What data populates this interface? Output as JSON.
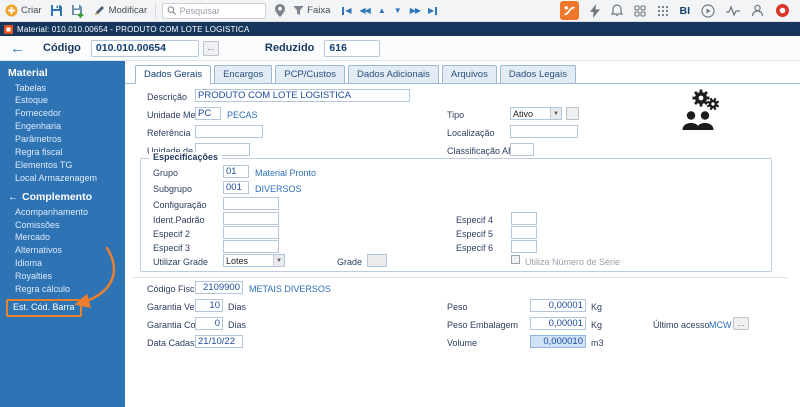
{
  "colors": {
    "accent": "#e7812d",
    "sidebar": "#2e73b4",
    "titlebar": "#16375d"
  },
  "toolbar": {
    "criar_label": "Criar",
    "modificar_label": "Modificar",
    "search_placeholder": "Pesquisar",
    "faixa_label": "Faixa",
    "bi_label": "BI"
  },
  "titlebar": {
    "title": "Material: 010.010.00654 - PRODUTO COM LOTE LOGISTICA"
  },
  "header": {
    "codigo_label": "Código",
    "codigo_value": "010.010.00654",
    "lookup_label": "...",
    "reduzido_label": "Reduzido",
    "reduzido_value": "616"
  },
  "sidebar": {
    "sections": [
      {
        "title": "Material",
        "items": [
          "Tabelas",
          "Estoque",
          "Fornecedor",
          "Engenharia",
          "Parâmetros",
          "Regra fiscal",
          "Elementos TG",
          "Local Armazenagem"
        ]
      },
      {
        "title": "Complemento",
        "items": [
          "Acompanhamento",
          "Comissões",
          "Mercado",
          "Alternativos",
          "Idioma",
          "Royalties",
          "Regra cálculo"
        ]
      }
    ],
    "highlighted_item": "Est. Cód. Barra"
  },
  "tabs": [
    "Dados Gerais",
    "Encargos",
    "PCP/Custos",
    "Dados Adicionais",
    "Arquivos",
    "Dados Legais"
  ],
  "form": {
    "descricao_label": "Descrição",
    "descricao_value": "PRODUTO COM LOTE LOGISTICA",
    "unidade_medida_label": "Unidade Medida",
    "unidade_medida_value": "PC",
    "unidade_medida_desc": "PECAS",
    "tipo_label": "Tipo",
    "tipo_value": "Ativo",
    "referencia_label": "Referência",
    "localizacao_label": "Localização",
    "unidade_negocio_label": "Unidade de Negócio",
    "classificacao_abc_label": "Classificação ABC",
    "especificacoes": {
      "title": "Especificações",
      "grupo_label": "Grupo",
      "grupo_value": "01",
      "grupo_desc": "Material Pronto",
      "subgrupo_label": "Subgrupo",
      "subgrupo_value": "001",
      "subgrupo_desc": "DIVERSOS",
      "configuracao_label": "Configuração",
      "ident_padrao_label": "Ident.Padrão",
      "especif2_label": "Especif 2",
      "especif3_label": "Especif 3",
      "especif4_label": "Especif 4",
      "especif5_label": "Especif 5",
      "especif6_label": "Especif 6",
      "utilizar_grade_label": "Utilizar Grade",
      "utilizar_grade_value": "Lotes",
      "grade_label": "Grade",
      "utiliza_serie_label": "Utiliza Número de Série"
    },
    "codigo_fiscal_label": "Código Fiscal",
    "codigo_fiscal_value": "2109900",
    "codigo_fiscal_desc": "METAIS DIVERSOS",
    "garantia_venda_label": "Garantia Venda",
    "garantia_venda_value": "10",
    "garantia_venda_unit": "Dias",
    "garantia_compra_label": "Garantia Compra",
    "garantia_compra_value": "0",
    "garantia_compra_unit": "Dias",
    "data_cadastro_label": "Data Cadastro",
    "data_cadastro_value": "21/10/22",
    "peso_label": "Peso",
    "peso_value": "0,00001",
    "peso_unit": "Kg",
    "peso_embalagem_label": "Peso Embalagem",
    "peso_embalagem_value": "0,00001",
    "peso_embalagem_unit": "Kg",
    "volume_label": "Volume",
    "volume_value": "0,000010",
    "volume_unit": "m3",
    "ultimo_acesso_label": "Último acesso",
    "ultimo_acesso_value": "MCW",
    "ultimo_acesso_lookup": "..."
  }
}
